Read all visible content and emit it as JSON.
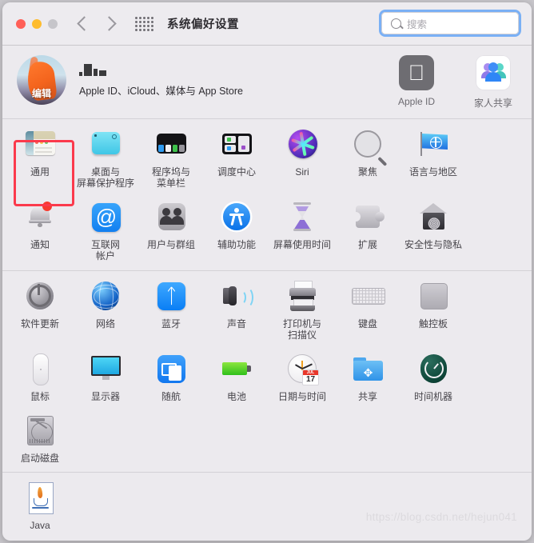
{
  "window": {
    "title": "系统偏好设置",
    "traffic_lights": [
      "close",
      "minimize",
      "zoom"
    ],
    "nav_back": "back-arrow",
    "nav_forward": "forward-arrow",
    "grid_button": "show-all-icon"
  },
  "search": {
    "placeholder": "搜索",
    "value": "",
    "icon": "search-icon",
    "focus_color": "#7ab0f5"
  },
  "account": {
    "avatar_overlay": "编辑",
    "name_redacted": true,
    "subtitle": "Apple ID、iCloud、媒体与 App Store",
    "items": [
      {
        "label": "Apple ID",
        "icon": "apple-logo-icon"
      },
      {
        "label": "家人共享",
        "icon": "family-sharing-icon"
      }
    ]
  },
  "highlight": {
    "target": "通用",
    "color": "#fb3a4c"
  },
  "sections": [
    {
      "name": "personal",
      "items": [
        {
          "label": "通用",
          "icon": "general-icon",
          "selected": true
        },
        {
          "label": "桌面与\n屏幕保护程序",
          "icon": "desktop-screensaver-icon"
        },
        {
          "label": "程序坞与\n菜单栏",
          "icon": "dock-menubar-icon"
        },
        {
          "label": "调度中心",
          "icon": "mission-control-icon"
        },
        {
          "label": "Siri",
          "icon": "siri-icon"
        },
        {
          "label": "聚焦",
          "icon": "spotlight-icon"
        },
        {
          "label": "语言与地区",
          "icon": "language-region-icon"
        },
        {
          "label": "通知",
          "icon": "notifications-icon",
          "badge": true
        },
        {
          "label": "互联网\n帐户",
          "icon": "internet-accounts-icon"
        },
        {
          "label": "用户与群组",
          "icon": "users-groups-icon"
        },
        {
          "label": "辅助功能",
          "icon": "accessibility-icon"
        },
        {
          "label": "屏幕使用时间",
          "icon": "screen-time-icon"
        },
        {
          "label": "扩展",
          "icon": "extensions-icon"
        },
        {
          "label": "安全性与隐私",
          "icon": "security-privacy-icon"
        }
      ]
    },
    {
      "name": "hardware",
      "items": [
        {
          "label": "软件更新",
          "icon": "software-update-icon"
        },
        {
          "label": "网络",
          "icon": "network-icon"
        },
        {
          "label": "蓝牙",
          "icon": "bluetooth-icon"
        },
        {
          "label": "声音",
          "icon": "sound-icon"
        },
        {
          "label": "打印机与\n扫描仪",
          "icon": "printers-scanners-icon"
        },
        {
          "label": "键盘",
          "icon": "keyboard-icon"
        },
        {
          "label": "触控板",
          "icon": "trackpad-icon"
        },
        {
          "label": "鼠标",
          "icon": "mouse-icon"
        },
        {
          "label": "显示器",
          "icon": "displays-icon"
        },
        {
          "label": "随航",
          "icon": "sidecar-icon"
        },
        {
          "label": "电池",
          "icon": "battery-icon"
        },
        {
          "label": "日期与时间",
          "icon": "date-time-icon"
        },
        {
          "label": "共享",
          "icon": "sharing-icon"
        },
        {
          "label": "时间机器",
          "icon": "time-machine-icon"
        },
        {
          "label": "启动磁盘",
          "icon": "startup-disk-icon"
        }
      ]
    },
    {
      "name": "other",
      "items": [
        {
          "label": "Java",
          "icon": "java-icon"
        }
      ]
    }
  ],
  "date_time_icon": {
    "month": "JUL",
    "day": "17"
  },
  "watermark": "https://blog.csdn.net/hejun041"
}
